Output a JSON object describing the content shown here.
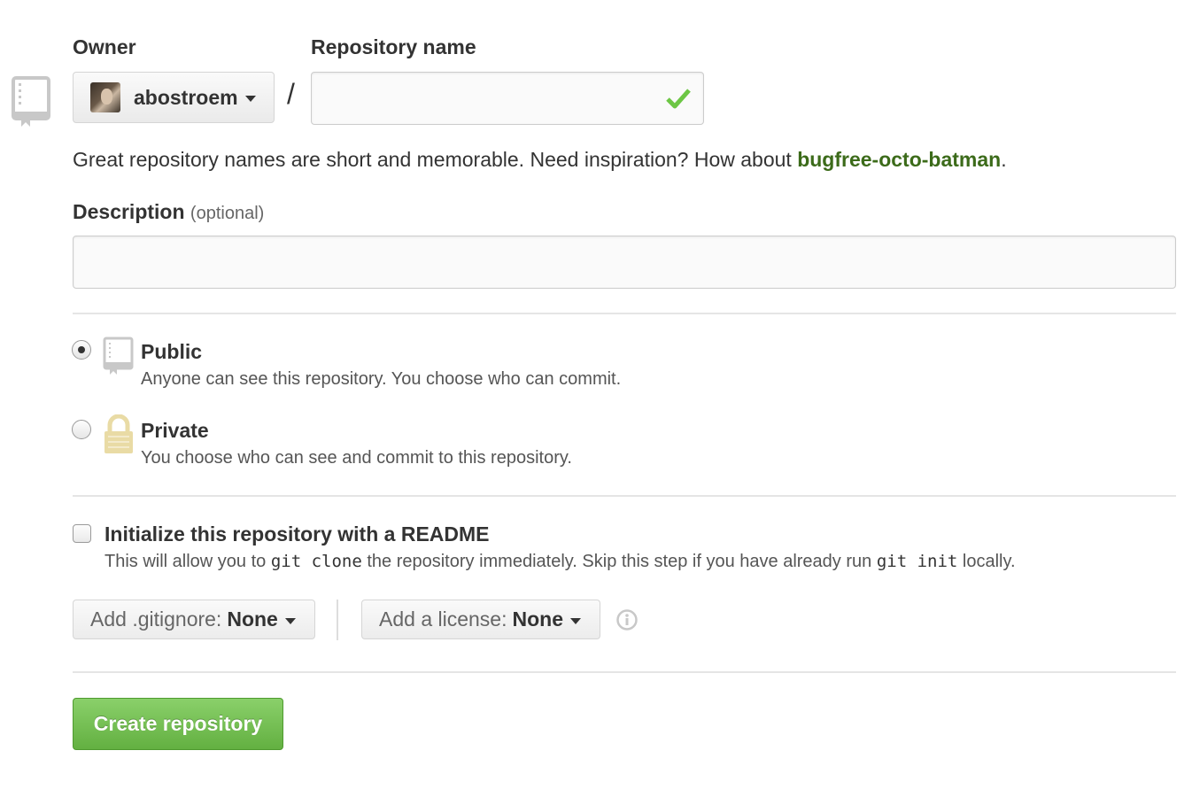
{
  "owner": {
    "label": "Owner",
    "selected": "abostroem"
  },
  "repository_name": {
    "label": "Repository name",
    "separator": "/",
    "value": "",
    "status": "valid"
  },
  "name_hint": {
    "text": "Great repository names are short and memorable. Need inspiration? How about ",
    "suggestion": "bugfree-octo-batman",
    "suffix": "."
  },
  "description": {
    "label": "Description",
    "optional_note": "(optional)",
    "value": ""
  },
  "visibility": {
    "selected": "public",
    "public": {
      "title": "Public",
      "description": "Anyone can see this repository. You choose who can commit."
    },
    "private": {
      "title": "Private",
      "description": "You choose who can see and commit to this repository."
    }
  },
  "readme": {
    "checked": false,
    "title": "Initialize this repository with a README",
    "desc_part1": "This will allow you to ",
    "code1": "git clone",
    "desc_part2": " the repository immediately. Skip this step if you have already run ",
    "code2": "git init",
    "desc_part3": " locally."
  },
  "gitignore": {
    "label": "Add .gitignore:",
    "value": "None"
  },
  "license": {
    "label": "Add a license:",
    "value": "None"
  },
  "create_button": {
    "label": "Create repository"
  },
  "colors": {
    "accent_green": "#6cc644",
    "suggestion_green": "#3c6b1a",
    "valid_check": "#6cc644",
    "lock_yellow": "#e9dba5"
  },
  "icons": {
    "repo": "repo-icon",
    "check": "check-icon",
    "lock": "lock-icon",
    "info": "info-icon",
    "caret": "caret-down-icon"
  }
}
